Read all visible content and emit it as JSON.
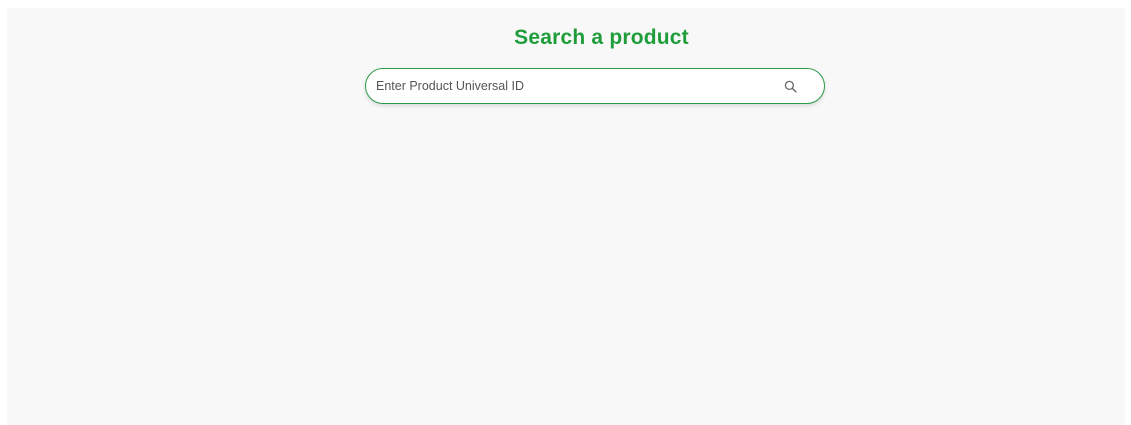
{
  "header": {
    "title": "Search a product"
  },
  "search": {
    "placeholder": "Enter Product Universal ID",
    "value": "",
    "icon": "search-icon"
  },
  "colors": {
    "accent": "#1f9d3a",
    "border": "#2e9a4a",
    "background": "#f8f8f9"
  }
}
